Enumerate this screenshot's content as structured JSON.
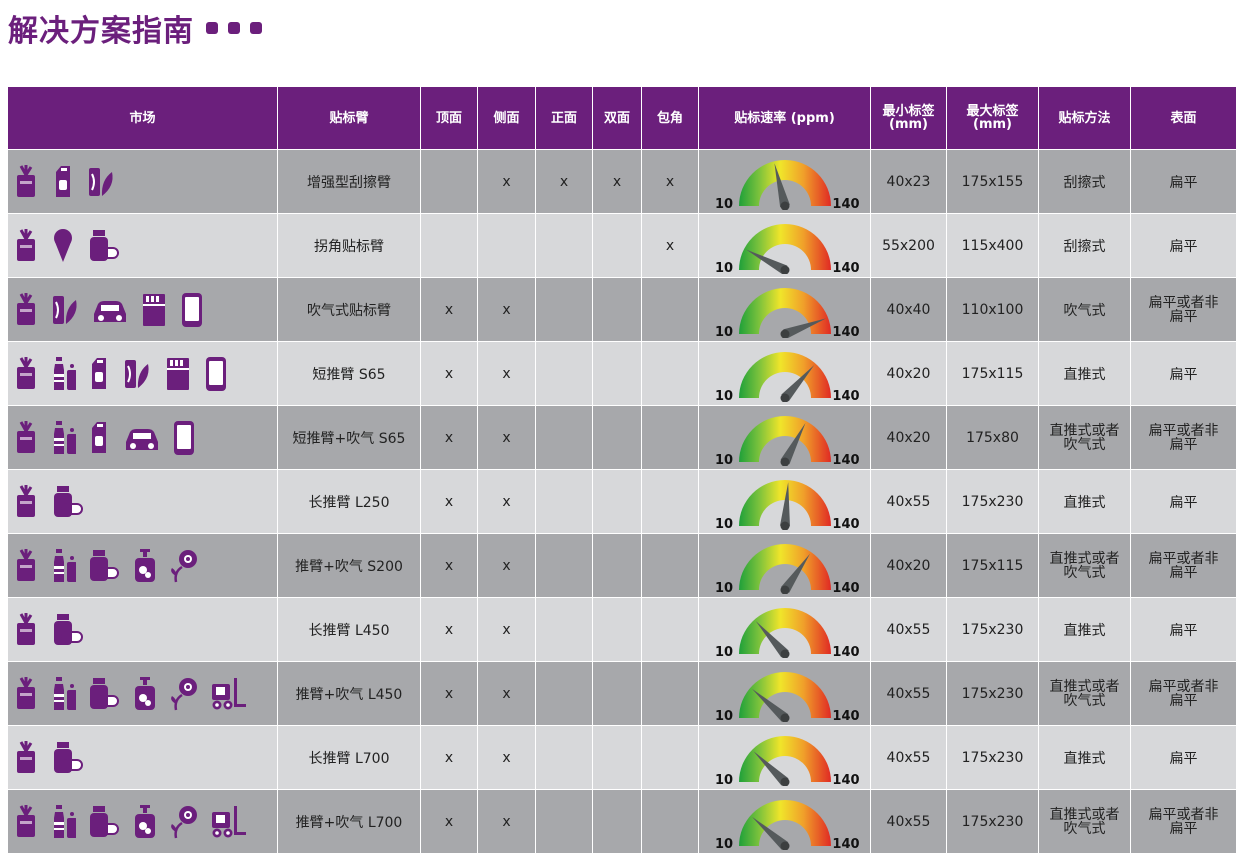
{
  "title": "解决方案指南",
  "colors": {
    "brand": "#6b1f7c",
    "row_dark": "#a7a8ab",
    "row_light": "#d7d8da"
  },
  "headers": {
    "market": "市场",
    "arm": "贴标臂",
    "top": "顶面",
    "side": "侧面",
    "front": "正面",
    "double": "双面",
    "wrap": "包角",
    "speed": "贴标速率 (ppm)",
    "min_label": [
      "最小标签",
      "(mm)"
    ],
    "max_label": [
      "最大标签",
      "(mm)"
    ],
    "method": "贴标方法",
    "surface": "表面"
  },
  "gauge_range": {
    "min": "10",
    "max": "140"
  },
  "rows": [
    {
      "icons": [
        "food-icon",
        "milk-carton-icon",
        "cosmetics-leaf-icon"
      ],
      "arm": "增强型刮擦臂",
      "top": "",
      "side": "x",
      "front": "x",
      "double": "x",
      "wrap": "x",
      "speed": 65,
      "min": "40x23",
      "max": "175x155",
      "method": "刮擦式",
      "surface": "扁平"
    },
    {
      "icons": [
        "food-icon",
        "ice-cream-icon",
        "pill-bottle-icon"
      ],
      "arm": "拐角贴标臂",
      "top": "",
      "side": "",
      "front": "",
      "double": "",
      "wrap": "x",
      "speed": 30,
      "min": "55x200",
      "max": "115x400",
      "method": "刮擦式",
      "surface": "扁平"
    },
    {
      "icons": [
        "food-icon",
        "cosmetics-leaf-icon",
        "car-icon",
        "cigarette-pack-icon",
        "phone-icon"
      ],
      "arm": "吹气式贴标臂",
      "top": "x",
      "side": "x",
      "front": "",
      "double": "",
      "wrap": "",
      "speed": 125,
      "min": "40x40",
      "max": "110x100",
      "method": "吹气式",
      "surface": [
        "扁平或者非",
        "扁平"
      ]
    },
    {
      "icons": [
        "food-icon",
        "bottles-icon",
        "milk-carton-icon",
        "cosmetics-leaf-icon",
        "cigarette-pack-icon",
        "phone-icon"
      ],
      "arm": "短推臂 S65",
      "top": "x",
      "side": "x",
      "front": "",
      "double": "",
      "wrap": "",
      "speed": 105,
      "min": "40x20",
      "max": "175x115",
      "method": "直推式",
      "surface": "扁平"
    },
    {
      "icons": [
        "food-icon",
        "bottles-icon",
        "milk-carton-icon",
        "car-icon",
        "phone-icon"
      ],
      "arm": "短推臂+吹气 S65",
      "top": "x",
      "side": "x",
      "front": "",
      "double": "",
      "wrap": "",
      "speed": 95,
      "min": "40x20",
      "max": "175x80",
      "method": [
        "直推式或者",
        "吹气式"
      ],
      "surface": [
        "扁平或者非",
        "扁平"
      ]
    },
    {
      "icons": [
        "food-icon",
        "pill-bottle-icon"
      ],
      "arm": "长推臂 L250",
      "top": "x",
      "side": "x",
      "front": "",
      "double": "",
      "wrap": "",
      "speed": 78,
      "min": "40x55",
      "max": "175x230",
      "method": "直推式",
      "surface": "扁平"
    },
    {
      "icons": [
        "food-icon",
        "bottles-icon",
        "pill-bottle-icon",
        "pump-bottle-icon",
        "flower-icon"
      ],
      "arm": "推臂+吹气 S200",
      "top": "x",
      "side": "x",
      "front": "",
      "double": "",
      "wrap": "",
      "speed": 100,
      "min": "40x20",
      "max": "175x115",
      "method": [
        "直推式或者",
        "吹气式"
      ],
      "surface": [
        "扁平或者非",
        "扁平"
      ]
    },
    {
      "icons": [
        "food-icon",
        "pill-bottle-icon"
      ],
      "arm": "长推臂 L450",
      "top": "x",
      "side": "x",
      "front": "",
      "double": "",
      "wrap": "",
      "speed": 45,
      "min": "40x55",
      "max": "175x230",
      "method": "直推式",
      "surface": "扁平"
    },
    {
      "icons": [
        "food-icon",
        "bottles-icon",
        "pill-bottle-icon",
        "pump-bottle-icon",
        "flower-icon",
        "forklift-icon"
      ],
      "arm": "推臂+吹气 L450",
      "top": "x",
      "side": "x",
      "front": "",
      "double": "",
      "wrap": "",
      "speed": 40,
      "min": "40x55",
      "max": "175x230",
      "method": [
        "直推式或者",
        "吹气式"
      ],
      "surface": [
        "扁平或者非",
        "扁平"
      ]
    },
    {
      "icons": [
        "food-icon",
        "pill-bottle-icon"
      ],
      "arm": "长推臂 L700",
      "top": "x",
      "side": "x",
      "front": "",
      "double": "",
      "wrap": "",
      "speed": 42,
      "min": "40x55",
      "max": "175x230",
      "method": "直推式",
      "surface": "扁平"
    },
    {
      "icons": [
        "food-icon",
        "bottles-icon",
        "pill-bottle-icon",
        "pump-bottle-icon",
        "flower-icon",
        "forklift-icon"
      ],
      "arm": "推臂+吹气 L700",
      "top": "x",
      "side": "x",
      "front": "",
      "double": "",
      "wrap": "",
      "speed": 40,
      "min": "40x55",
      "max": "175x230",
      "method": [
        "直推式或者",
        "吹气式"
      ],
      "surface": [
        "扁平或者非",
        "扁平"
      ]
    }
  ]
}
